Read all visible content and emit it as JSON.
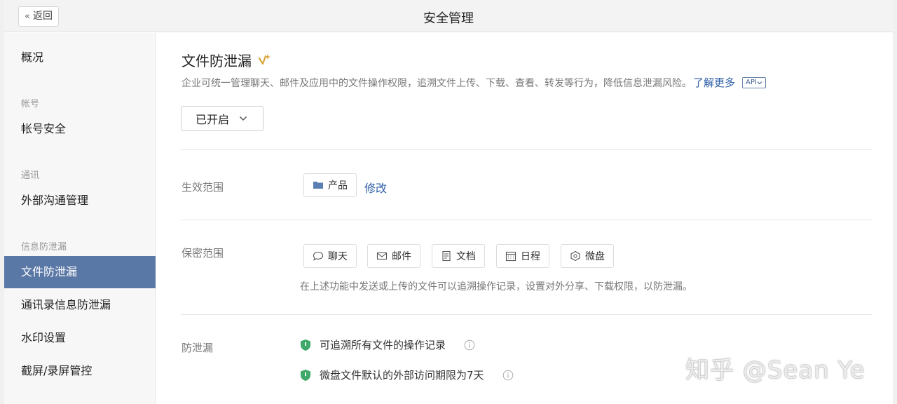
{
  "header": {
    "back_label": "返回",
    "title": "安全管理"
  },
  "sidebar": {
    "overview": "概况",
    "group_account": "帐号",
    "account_security": "帐号安全",
    "group_comm": "通讯",
    "external_comm": "外部沟通管理",
    "group_leak": "信息防泄漏",
    "file_leak": "文件防泄漏",
    "contacts_leak": "通讯录信息防泄漏",
    "watermark": "水印设置",
    "screenshot": "截屏/录屏管控"
  },
  "main": {
    "title": "文件防泄漏",
    "description": "企业可统一管理聊天、邮件及应用中的文件操作权限，追溯文件上传、下载、查看、转发等行为，降低信息泄漏风险。",
    "learn_more": "了解更多",
    "api_badge": "API",
    "status": "已开启",
    "scope_label": "生效范围",
    "scope_value": "产品",
    "modify": "修改",
    "secret_label": "保密范围",
    "secret_items": [
      "聊天",
      "邮件",
      "文档",
      "日程",
      "微盘"
    ],
    "secret_hint": "在上述功能中发送或上传的文件可以追溯操作记录，设置对外分享、下载权限，以防泄漏。",
    "leak_label": "防泄漏",
    "leak_items": [
      "可追溯所有文件的操作记录",
      "微盘文件默认的外部访问期限为7天"
    ]
  },
  "watermark_text": "知乎 @Sean Ye",
  "colors": {
    "active": "#5a78a6",
    "link": "#2f5fa8",
    "shield": "#3fa86a"
  }
}
